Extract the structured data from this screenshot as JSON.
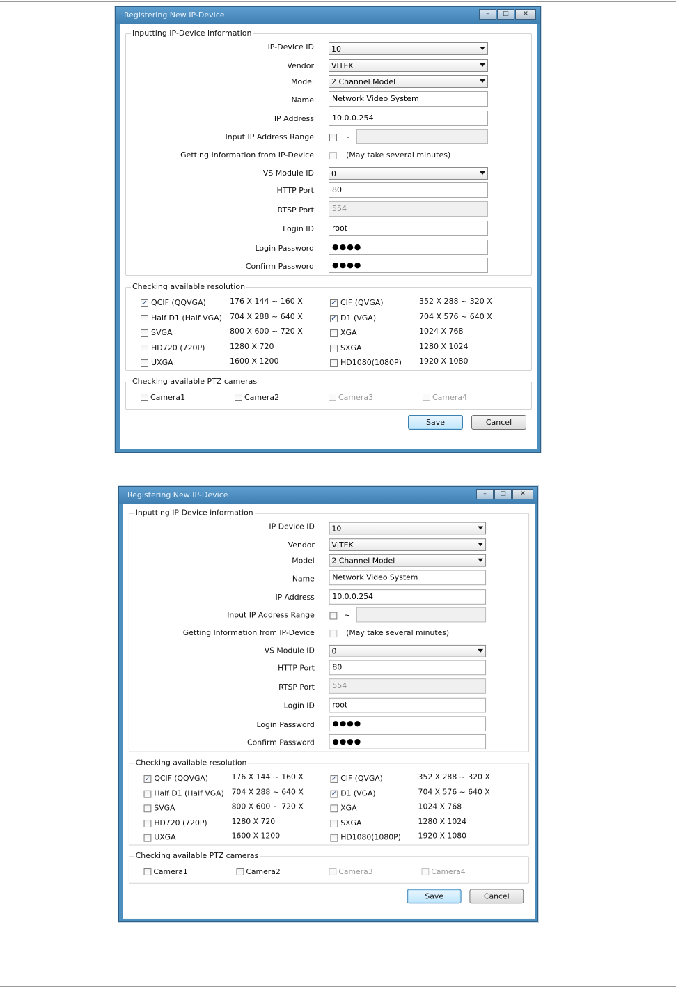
{
  "dialog": {
    "title": "Registering New IP-Device",
    "window_buttons": {
      "minimize": "–",
      "maximize": "□",
      "close": "✕"
    }
  },
  "device_info": {
    "legend": "Inputting IP-Device information",
    "labels": {
      "device_id": "IP-Device ID",
      "vendor": "Vendor",
      "model": "Model",
      "name": "Name",
      "ip_address": "IP Address",
      "ip_range": "Input IP Address Range",
      "get_info": "Getting Information from IP-Device",
      "vs_module": "VS Module ID",
      "http_port": "HTTP Port",
      "rtsp_port": "RTSP Port",
      "login_id": "Login ID",
      "login_password": "Login Password",
      "confirm_password": "Confirm Password"
    },
    "values": {
      "device_id": "10",
      "vendor": "VITEK",
      "model": "2 Channel Model",
      "name": "Network Video System",
      "ip_address": "10.0.0.254",
      "ip_range_separator": "~",
      "ip_range_end": "",
      "get_info_note": "(May take several minutes)",
      "vs_module": "0",
      "http_port": "80",
      "rtsp_port": "554",
      "login_id": "root",
      "login_password": "●●●●",
      "confirm_password": "●●●●"
    },
    "checks": {
      "ip_range": false,
      "get_info": false
    }
  },
  "resolution": {
    "legend": "Checking available resolution",
    "left": [
      {
        "name": "QCIF (QQVGA)",
        "range": "176 X 144 ~ 160 X",
        "checked": true
      },
      {
        "name": "Half D1 (Half VGA)",
        "range": "704 X 288 ~ 640 X",
        "checked": false
      },
      {
        "name": "SVGA",
        "range": "800 X 600 ~ 720 X",
        "checked": false
      },
      {
        "name": "HD720 (720P)",
        "range": "1280 X 720",
        "checked": false
      },
      {
        "name": "UXGA",
        "range": "1600 X 1200",
        "checked": false
      }
    ],
    "right": [
      {
        "name": "CIF (QVGA)",
        "range": "352 X 288 ~ 320 X",
        "checked": true
      },
      {
        "name": "D1 (VGA)",
        "range": "704 X 576 ~ 640 X",
        "checked": true
      },
      {
        "name": "XGA",
        "range": "1024 X 768",
        "checked": false
      },
      {
        "name": "SXGA",
        "range": "1280 X 1024",
        "checked": false
      },
      {
        "name": "HD1080(1080P)",
        "range": "1920 X 1080",
        "checked": false
      }
    ]
  },
  "ptz": {
    "legend": "Checking available PTZ cameras",
    "cameras": [
      {
        "name": "Camera1",
        "enabled": true
      },
      {
        "name": "Camera2",
        "enabled": true
      },
      {
        "name": "Camera3",
        "enabled": false
      },
      {
        "name": "Camera4",
        "enabled": false
      }
    ]
  },
  "buttons": {
    "save": "Save",
    "cancel": "Cancel"
  }
}
